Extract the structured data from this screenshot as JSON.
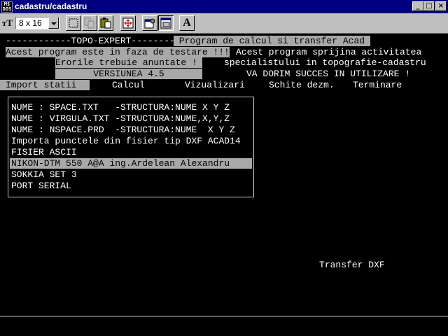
{
  "window": {
    "title": "cadastru/cadastru",
    "icon_lines": [
      "M$",
      "DOS"
    ],
    "minimize": "_",
    "maximize": "□",
    "close": "×"
  },
  "toolbar": {
    "font_size": "8 x 16"
  },
  "console": {
    "header_left": "------------TOPO-EXPERT--------",
    "header_right": " Program de calcul si transfer Acad ",
    "line2_left": "Acest program este in faza de testare !!!",
    "line2_right": "Acest program sprijina activitatea",
    "line3_left": "Erorile trebuie anuntate !",
    "line3_right": "specialistului in topografie-cadastru",
    "line4_left": "VERSIUNEA 4.5",
    "line4_right": "VA DORIM SUCCES IN UTILIZARE !"
  },
  "menu": [
    {
      "label": "Import statii",
      "selected": true
    },
    {
      "label": "Calcul",
      "selected": false
    },
    {
      "label": "Vizualizari",
      "selected": false
    },
    {
      "label": "Schite dezm.",
      "selected": false
    },
    {
      "label": "Terminare",
      "selected": false
    }
  ],
  "import_list": [
    "NUME : SPACE.TXT   -STRUCTURA:NUME X Y Z",
    "NUME : VIRGULA.TXT -STRUCTURA:NUME,X,Y,Z",
    "NUME : NSPACE.PRD  -STRUCTURA:NUME  X Y Z",
    "Importa punctele din fisier tip DXF ACAD14",
    "FISIER ASCII",
    "NIKON-DTM 550 A@A ing.Ardelean Alexandru",
    "SOKKIA SET 3",
    "PORT SERIAL"
  ],
  "selected_list_index": 5,
  "status_hint": "Transfer DXF"
}
